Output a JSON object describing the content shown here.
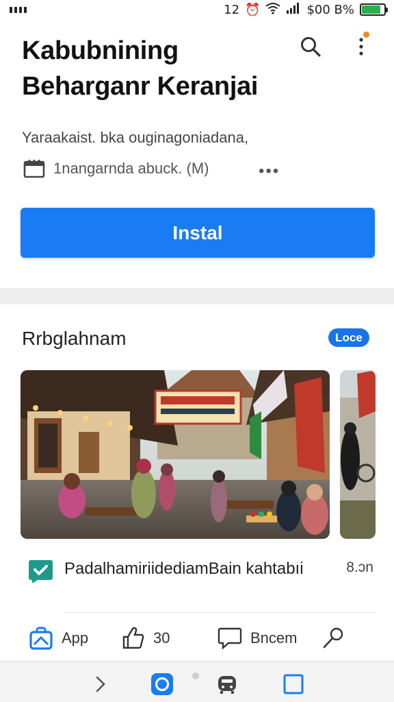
{
  "status_bar": {
    "time": "12",
    "battery_text": "$00 B%",
    "battery_level": 0.85,
    "battery_color": "#2bb24c"
  },
  "header": {
    "title": "Kabubnining Beharganr Keranjai",
    "search_icon": "search-icon",
    "more_icon": "more-vert-icon",
    "notification_color": "#f28a22"
  },
  "app_info": {
    "subtitle": "Yaraakaist. bka ouginagoniadana,",
    "meta_text": "1nangarnda abuck. (M)",
    "more_label": "•••"
  },
  "install": {
    "label": "Instal",
    "color": "#1a7cf3"
  },
  "section": {
    "title": "Rrbglahnam",
    "badge": "Loce",
    "badge_color": "#1a73e8"
  },
  "post": {
    "text": "PadalhamiriidediamBain kahtabıi",
    "time": "8.ɔn",
    "icon": "check-chat-icon",
    "icon_color": "#1d9a8a"
  },
  "actions": [
    {
      "label": "App",
      "icon": "app-bag-icon"
    },
    {
      "label": "30",
      "icon": "thumbs-up-icon"
    },
    {
      "label": "Bncem",
      "icon": "comment-icon"
    },
    {
      "label": "",
      "icon": "pin-icon"
    }
  ],
  "bottom_nav": {
    "items": [
      "forward-arrow-icon",
      "app-circle-icon",
      "car-icon",
      "square-icon"
    ],
    "accent": "#1a7cf3"
  }
}
